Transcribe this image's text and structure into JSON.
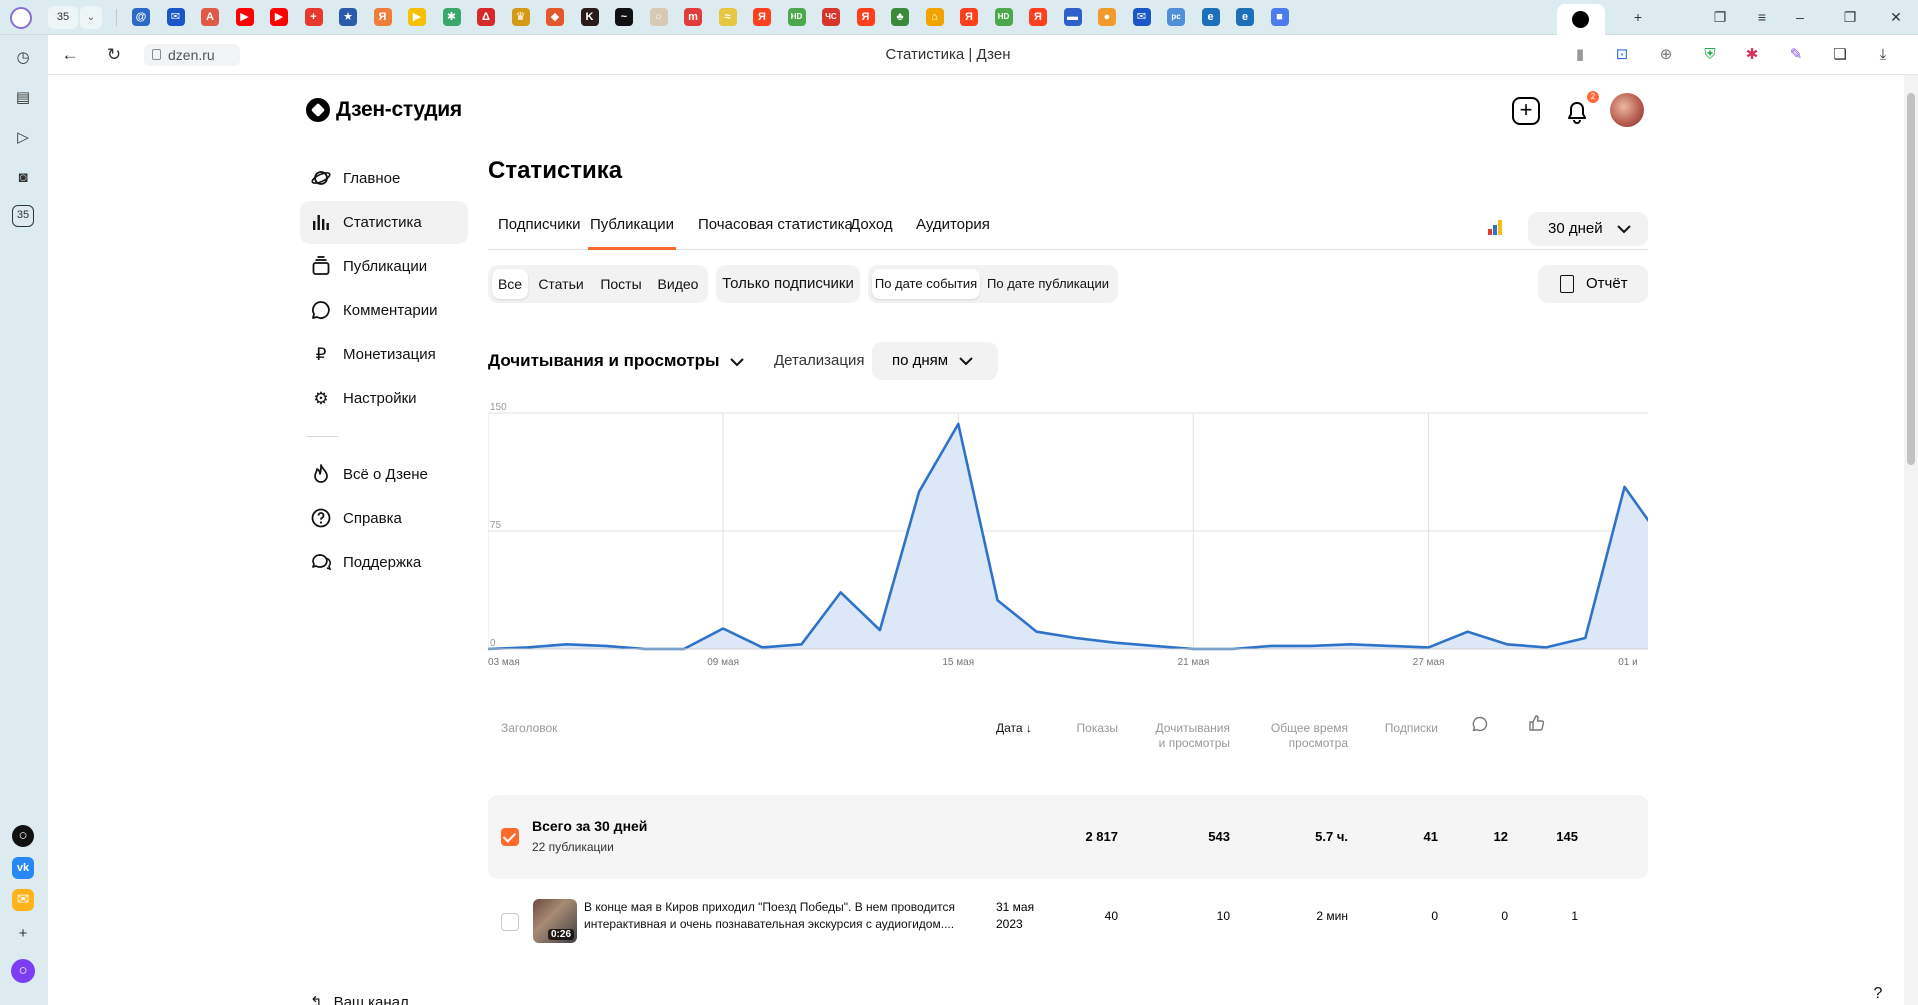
{
  "browser": {
    "tab_count": "35",
    "url": "dzen.ru",
    "page_title": "Статистика | Дзен",
    "rail_badge": "35",
    "favicons": [
      {
        "name": "mail-ru",
        "color": "#2d68c4",
        "glyph": "@"
      },
      {
        "name": "mail",
        "color": "#1a56c8",
        "glyph": "✉"
      },
      {
        "name": "doc",
        "color": "#e05a47",
        "glyph": "A"
      },
      {
        "name": "youtube",
        "color": "#ff0000",
        "glyph": "▶"
      },
      {
        "name": "youtube",
        "color": "#ff0000",
        "glyph": "▶"
      },
      {
        "name": "plus-red",
        "color": "#e8392f",
        "glyph": "+"
      },
      {
        "name": "star",
        "color": "#2b5aa8",
        "glyph": "★"
      },
      {
        "name": "ya-service",
        "color": "#f07e3b",
        "glyph": "Я"
      },
      {
        "name": "play-yellow",
        "color": "#f5c000",
        "glyph": "▶"
      },
      {
        "name": "green-star",
        "color": "#3aa76d",
        "glyph": "✱"
      },
      {
        "name": "triangle",
        "color": "#d52a2a",
        "glyph": "Δ"
      },
      {
        "name": "crown",
        "color": "#d39a18",
        "glyph": "♛"
      },
      {
        "name": "shield",
        "color": "#e2572b",
        "glyph": "◆"
      },
      {
        "name": "dark-k",
        "color": "#2a1a1a",
        "glyph": "K"
      },
      {
        "name": "wave",
        "color": "#111111",
        "glyph": "~"
      },
      {
        "name": "circle-light",
        "color": "#d8c9b5",
        "glyph": "○"
      },
      {
        "name": "mt",
        "color": "#e23b3b",
        "glyph": "m"
      },
      {
        "name": "yellow",
        "color": "#e7c640",
        "glyph": "≈"
      },
      {
        "name": "ya",
        "color": "#fc3f1d",
        "glyph": "Я"
      },
      {
        "name": "hd",
        "color": "#4ca84c",
        "glyph": "HD"
      },
      {
        "name": "chs",
        "color": "#d6362b",
        "glyph": "ЧС"
      },
      {
        "name": "ya",
        "color": "#fc3f1d",
        "glyph": "Я"
      },
      {
        "name": "tree",
        "color": "#3b8a3b",
        "glyph": "♣"
      },
      {
        "name": "home",
        "color": "#f1a400",
        "glyph": "⌂"
      },
      {
        "name": "ya",
        "color": "#fc3f1d",
        "glyph": "Я"
      },
      {
        "name": "hd",
        "color": "#4ca84c",
        "glyph": "HD"
      },
      {
        "name": "ya",
        "color": "#fc3f1d",
        "glyph": "Я"
      },
      {
        "name": "flag-ru",
        "color": "#2f5fc8",
        "glyph": "▬"
      },
      {
        "name": "orange-blob",
        "color": "#f39a2f",
        "glyph": "●"
      },
      {
        "name": "mail",
        "color": "#1a56c8",
        "glyph": "✉"
      },
      {
        "name": "pcb",
        "color": "#4f8fd8",
        "glyph": "pc"
      },
      {
        "name": "edge",
        "color": "#1d6fb8",
        "glyph": "e"
      },
      {
        "name": "edge",
        "color": "#1d6fb8",
        "glyph": "e"
      },
      {
        "name": "blue-square",
        "color": "#4b7bec",
        "glyph": "■"
      }
    ]
  },
  "header": {
    "logo_text": "Дзен-студия",
    "notifications_count": "2"
  },
  "sidebar": {
    "items": [
      {
        "label": "Главное",
        "icon": "planet-icon"
      },
      {
        "label": "Статистика",
        "icon": "bar-chart-icon"
      },
      {
        "label": "Публикации",
        "icon": "stack-icon"
      },
      {
        "label": "Комментарии",
        "icon": "comment-icon"
      },
      {
        "label": "Монетизация",
        "icon": "ruble-icon"
      },
      {
        "label": "Настройки",
        "icon": "gear-icon"
      }
    ],
    "secondary": [
      {
        "label": "Всё о Дзене",
        "icon": "flame-icon"
      },
      {
        "label": "Справка",
        "icon": "question-icon"
      },
      {
        "label": "Поддержка",
        "icon": "chat-icon"
      }
    ],
    "channel_label": "Ваш канал"
  },
  "main": {
    "title": "Статистика",
    "tabs": [
      "Подписчики",
      "Публикации",
      "Почасовая статистика",
      "Доход",
      "Аудитория"
    ],
    "active_tab": "Публикации",
    "period": "30 дней",
    "type_filters": [
      "Все",
      "Статьи",
      "Посты",
      "Видео"
    ],
    "subscribers_only": "Только подписчики",
    "date_modes": [
      "По дате события",
      "По дате публикации"
    ],
    "report_label": "Отчёт",
    "metric": "Дочитывания и просмотры",
    "detail_label": "Детализация",
    "detail_value": "по дням"
  },
  "chart_data": {
    "type": "area",
    "x_tick_labels": [
      "03 мая",
      "09 мая",
      "15 мая",
      "21 мая",
      "27 мая",
      "01 и"
    ],
    "y_ticks": [
      0,
      75,
      150
    ],
    "ylim": [
      0,
      150
    ],
    "grid": true,
    "color": "#2e73c9",
    "fill": "#dce8f8",
    "values": [
      0,
      1,
      3,
      2,
      0,
      0,
      13,
      1,
      3,
      36,
      12,
      100,
      143,
      31,
      11,
      7,
      4,
      2,
      0,
      0,
      2,
      2,
      3,
      2,
      1,
      11,
      3,
      1,
      7,
      103,
      68
    ]
  },
  "table": {
    "headers": {
      "title": "Заголовок",
      "date": "Дата",
      "impressions": "Показы",
      "reads_line1": "Дочитывания",
      "reads_line2": "и просмотры",
      "time_line1": "Общее время",
      "time_line2": "просмотра",
      "subs": "Подписки"
    },
    "total": {
      "title": "Всего за 30 дней",
      "subtitle": "22 публикации",
      "impressions": "2 817",
      "reads": "543",
      "time": "5.7 ч.",
      "subs": "41",
      "comments": "12",
      "likes": "145"
    },
    "rows": [
      {
        "title_line1": "В конце мая в Киров приходил \"Поезд Победы\". В нем проводится",
        "title_line2": "интерактивная и очень познавательная экскурсия с аудиогидом....",
        "duration": "0:26",
        "date_line1": "31 мая",
        "date_line2": "2023",
        "impressions": "40",
        "reads": "10",
        "time": "2 мин",
        "subs": "0",
        "comments": "0",
        "likes": "1"
      }
    ]
  }
}
